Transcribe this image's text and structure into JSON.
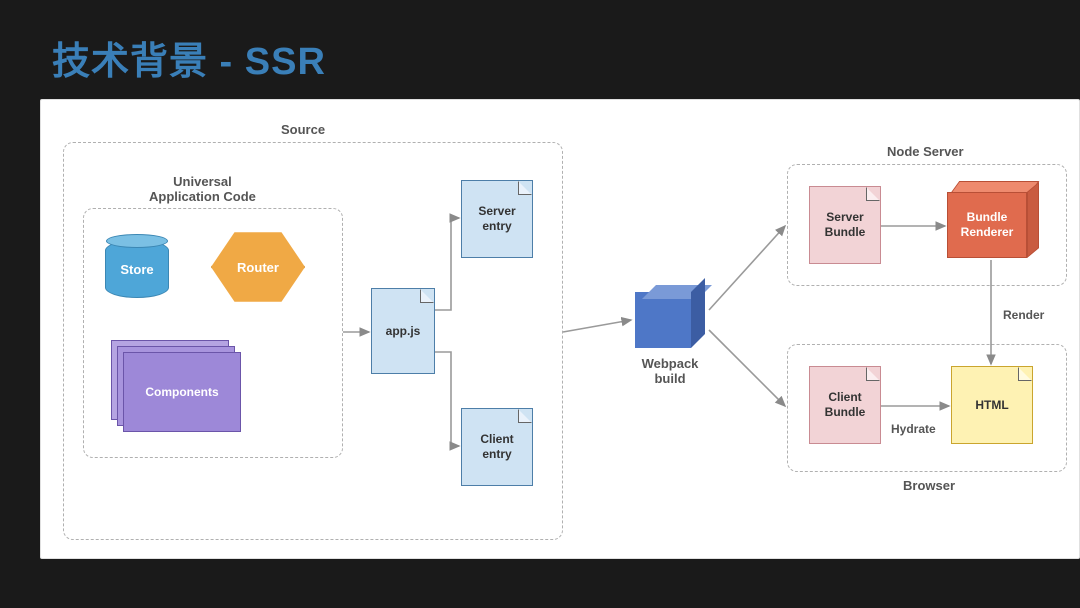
{
  "title": "技术背景 - SSR",
  "groups": {
    "source": "Source",
    "universal": "Universal\nApplication Code",
    "nodeServer": "Node Server",
    "browser": "Browser"
  },
  "nodes": {
    "store": "Store",
    "router": "Router",
    "components": "Components",
    "appjs": "app.js",
    "serverEntry": "Server\nentry",
    "clientEntry": "Client\nentry",
    "webpackBuild": "Webpack\nbuild",
    "serverBundle": "Server\nBundle",
    "clientBundle": "Client\nBundle",
    "bundleRenderer": "Bundle\nRenderer",
    "html": "HTML"
  },
  "edges": {
    "render": "Render",
    "hydrate": "Hydrate"
  },
  "colors": {
    "title": "#3a7fb8",
    "fileBlue": "#cfe3f3",
    "filePink": "#f2d3d6",
    "fileYellow": "#fef2b3",
    "cylinder": "#4ea6d8",
    "hexagon": "#f0a945",
    "stack": "#9d88d8",
    "cube": "#4e77c7",
    "box3d": "#e06b4e"
  }
}
